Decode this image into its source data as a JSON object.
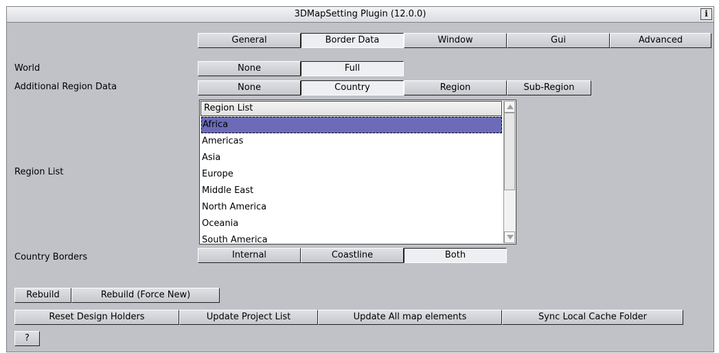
{
  "window": {
    "title": "3DMapSetting Plugin (12.0.0)",
    "info_label": "i"
  },
  "tabs": [
    "General",
    "Border Data",
    "Window",
    "Gui",
    "Advanced"
  ],
  "world": {
    "label": "World",
    "options": [
      "None",
      "Full"
    ],
    "selected": "Full"
  },
  "additional_region": {
    "label": "Additional Region Data",
    "options": [
      "None",
      "Country",
      "Region",
      "Sub-Region"
    ],
    "selected": "Country"
  },
  "region_list": {
    "label": "Region List",
    "header": "Region List",
    "items": [
      "Africa",
      "Americas",
      "Asia",
      "Europe",
      "Middle East",
      "North America",
      "Oceania",
      "South America"
    ],
    "selected": "Africa"
  },
  "country_borders": {
    "label": "Country Borders",
    "options": [
      "Internal",
      "Coastline",
      "Both"
    ],
    "selected": "Both"
  },
  "actions": {
    "rebuild": "Rebuild",
    "rebuild_force": "Rebuild (Force New)",
    "reset_design_holders": "Reset Design Holders",
    "update_project_list": "Update Project List",
    "update_all_map_elements": "Update All map elements",
    "sync_local_cache": "Sync Local Cache Folder",
    "help": "?"
  }
}
